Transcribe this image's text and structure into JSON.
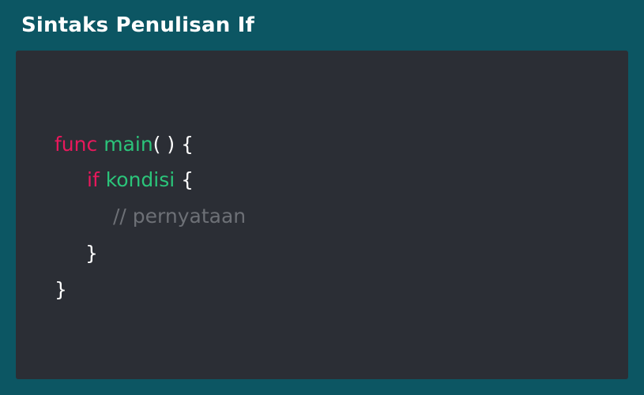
{
  "header": {
    "title": "Sintaks Penulisan If"
  },
  "code": {
    "line1": {
      "keyword": "func",
      "name": "main",
      "parens": "( )",
      "brace": "{"
    },
    "line2": {
      "keyword": "if",
      "condition": "kondisi",
      "brace": "{"
    },
    "line3": {
      "comment": "// pernyataan"
    },
    "line4": {
      "brace": "}"
    },
    "line5": {
      "brace": "}"
    }
  },
  "colors": {
    "background": "#0c5663",
    "panel": "#2b2e35",
    "keyword": "#e8185c",
    "identifier": "#2bc47a",
    "punctuation": "#ffffff",
    "comment": "#6d7076"
  }
}
